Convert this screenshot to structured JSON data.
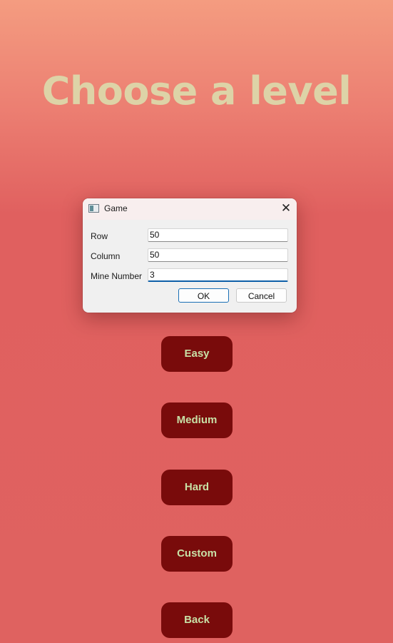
{
  "screen": {
    "title": "Choose a level"
  },
  "levels": [
    {
      "label": "Easy"
    },
    {
      "label": "Medium"
    },
    {
      "label": "Hard"
    },
    {
      "label": "Custom"
    },
    {
      "label": "Back"
    }
  ],
  "dialog": {
    "title": "Game",
    "close_icon": "close-icon",
    "fields": {
      "row": {
        "label": "Row",
        "value": "50"
      },
      "column": {
        "label": "Column",
        "value": "50"
      },
      "mines": {
        "label": "Mine Number",
        "value": "3"
      }
    },
    "ok_label": "OK",
    "cancel_label": "Cancel"
  },
  "colors": {
    "background_top": "#f49c80",
    "background_bottom": "#df6260",
    "title_text": "#ddd3a7",
    "button_fill": "#790b0b",
    "button_text": "#c8e0a6",
    "focus_accent": "#0e5fa8"
  }
}
